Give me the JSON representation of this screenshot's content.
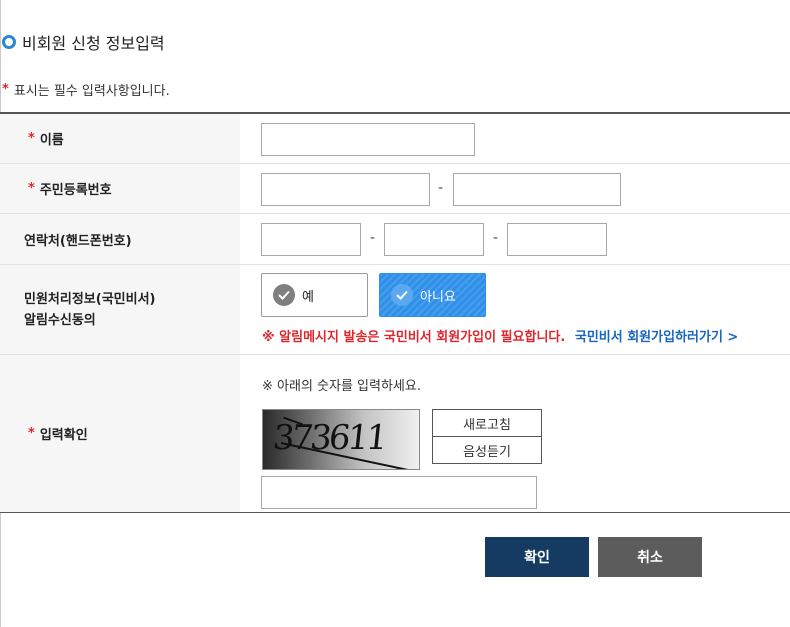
{
  "page": {
    "title": "비회원 신청 정보입력"
  },
  "required_note": {
    "star": "*",
    "text": "표시는 필수 입력사항입니다."
  },
  "fields": {
    "name": {
      "label": "이름",
      "value": ""
    },
    "rrn": {
      "label": "주민등록번호",
      "separator": "-",
      "part1": "",
      "part2": ""
    },
    "phone": {
      "label": "연락처(핸드폰번호)",
      "separator": "-",
      "part1": "",
      "part2": "",
      "part3": ""
    },
    "consent": {
      "label_line1": "민원처리정보(국민비서)",
      "label_line2": "알림수신동의",
      "yes_label": "예",
      "no_label": "아니요",
      "selected": "아니요",
      "warning": "※ 알림메시지 발송은 국민비서 회원가입이 필요합니다.",
      "link": "국민비서 회원가입하러가기 >"
    },
    "captcha": {
      "label": "입력확인",
      "guide": "※ 아래의 숫자를 입력하세요.",
      "code": "373611",
      "refresh_label": "새로고침",
      "audio_label": "음성듣기",
      "value": ""
    }
  },
  "actions": {
    "confirm_label": "확인",
    "cancel_label": "취소"
  },
  "colors": {
    "accent": "#2e90e8",
    "required": "#e0262c",
    "link": "#1766c2",
    "confirm": "#163b63",
    "cancel": "#5c5c5c"
  }
}
